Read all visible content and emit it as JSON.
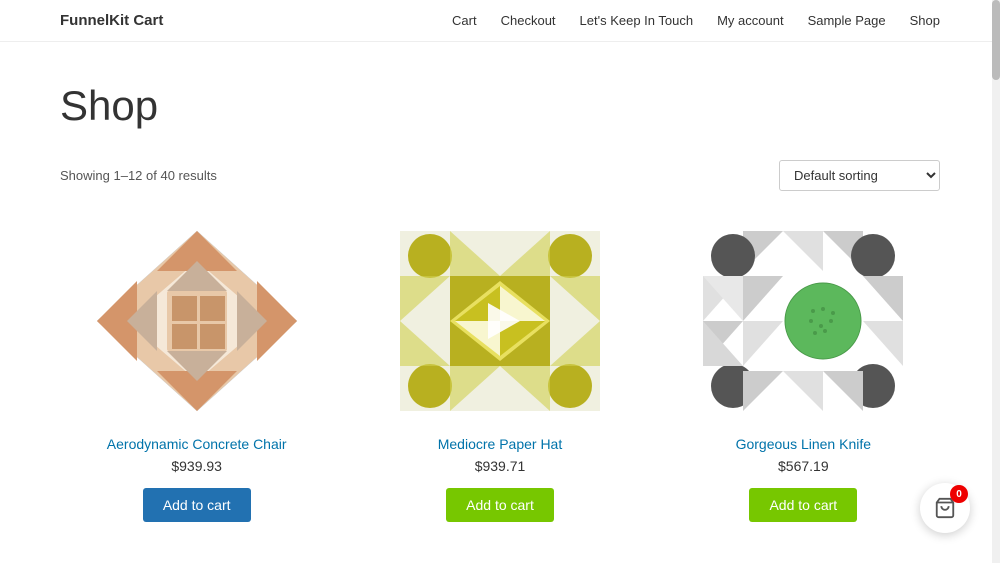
{
  "site": {
    "title": "FunnelKit Cart"
  },
  "nav": {
    "items": [
      {
        "label": "Cart",
        "href": "#"
      },
      {
        "label": "Checkout",
        "href": "#"
      },
      {
        "label": "Let's Keep In Touch",
        "href": "#"
      },
      {
        "label": "My account",
        "href": "#"
      },
      {
        "label": "Sample Page",
        "href": "#"
      },
      {
        "label": "Shop",
        "href": "#"
      }
    ]
  },
  "page": {
    "title": "Shop",
    "result_count": "Showing 1–12 of 40 results",
    "sort_default": "Default sorting"
  },
  "products": [
    {
      "name": "Aerodynamic Concrete Chair",
      "price": "$939.93",
      "btn_label": "Add to cart",
      "btn_style": "blue"
    },
    {
      "name": "Mediocre Paper Hat",
      "price": "$939.71",
      "btn_label": "Add to cart",
      "btn_style": "green"
    },
    {
      "name": "Gorgeous Linen Knife",
      "price": "$567.19",
      "btn_label": "Add to cart",
      "btn_style": "green"
    }
  ],
  "cart": {
    "count": "0"
  }
}
